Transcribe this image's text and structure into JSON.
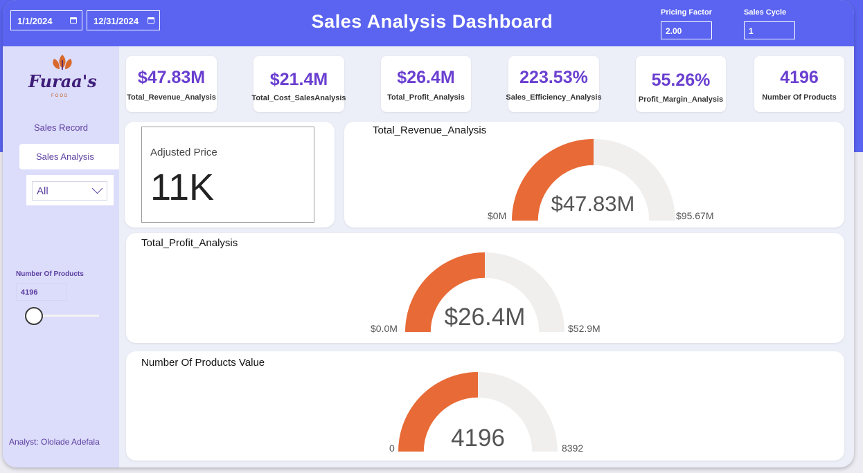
{
  "header": {
    "start_date": "1/1/2024",
    "end_date": "12/31/2024",
    "title": "Sales Analysis Dashboard",
    "pricing_factor_label": "Pricing Factor",
    "pricing_factor_value": "2.00",
    "sales_cycle_label": "Sales Cycle",
    "sales_cycle_value": "1"
  },
  "sidebar": {
    "logo_text": "Furaa's",
    "logo_sub": "FOOD",
    "nav_sales_record": "Sales Record",
    "nav_sales_analysis": "Sales Analysis",
    "slicer_value": "All",
    "products_label": "Number Of Products",
    "products_value": "4196",
    "products_slider_fraction": 0.13,
    "analyst": "Analyst: Ololade Adefala"
  },
  "kpis": [
    {
      "value": "$47.83M",
      "label": "Total_Revenue_Analysis"
    },
    {
      "value": "$21.4M",
      "label": "Total_Cost_SalesAnalysis"
    },
    {
      "value": "$26.4M",
      "label": "Total_Profit_Analysis"
    },
    {
      "value": "223.53%",
      "label": "Sales_Efficiency_Analysis"
    },
    {
      "value": "55.26%",
      "label": "Profit_Margin_Analysis"
    },
    {
      "value": "4196",
      "label": "Number Of Products"
    }
  ],
  "adjusted_price": {
    "label": "Adjusted Price",
    "value": "11K"
  },
  "gauges": {
    "revenue": {
      "title": "Total_Revenue_Analysis",
      "center": "$47.83M",
      "min": "$0M",
      "max": "$95.67M",
      "fraction": 0.5
    },
    "profit": {
      "title": "Total_Profit_Analysis",
      "center": "$26.4M",
      "min": "$0.0M",
      "max": "$52.9M",
      "fraction": 0.5
    },
    "products": {
      "title": "Number Of Products Value",
      "center": "4196",
      "min": "0",
      "max": "8392",
      "fraction": 0.5
    }
  },
  "colors": {
    "header": "#5a64f0",
    "gauge_fill": "#e86a36",
    "gauge_track": "#f0efee",
    "accent_text": "#6a3fd0",
    "sidebar": "#dcdcfb"
  }
}
